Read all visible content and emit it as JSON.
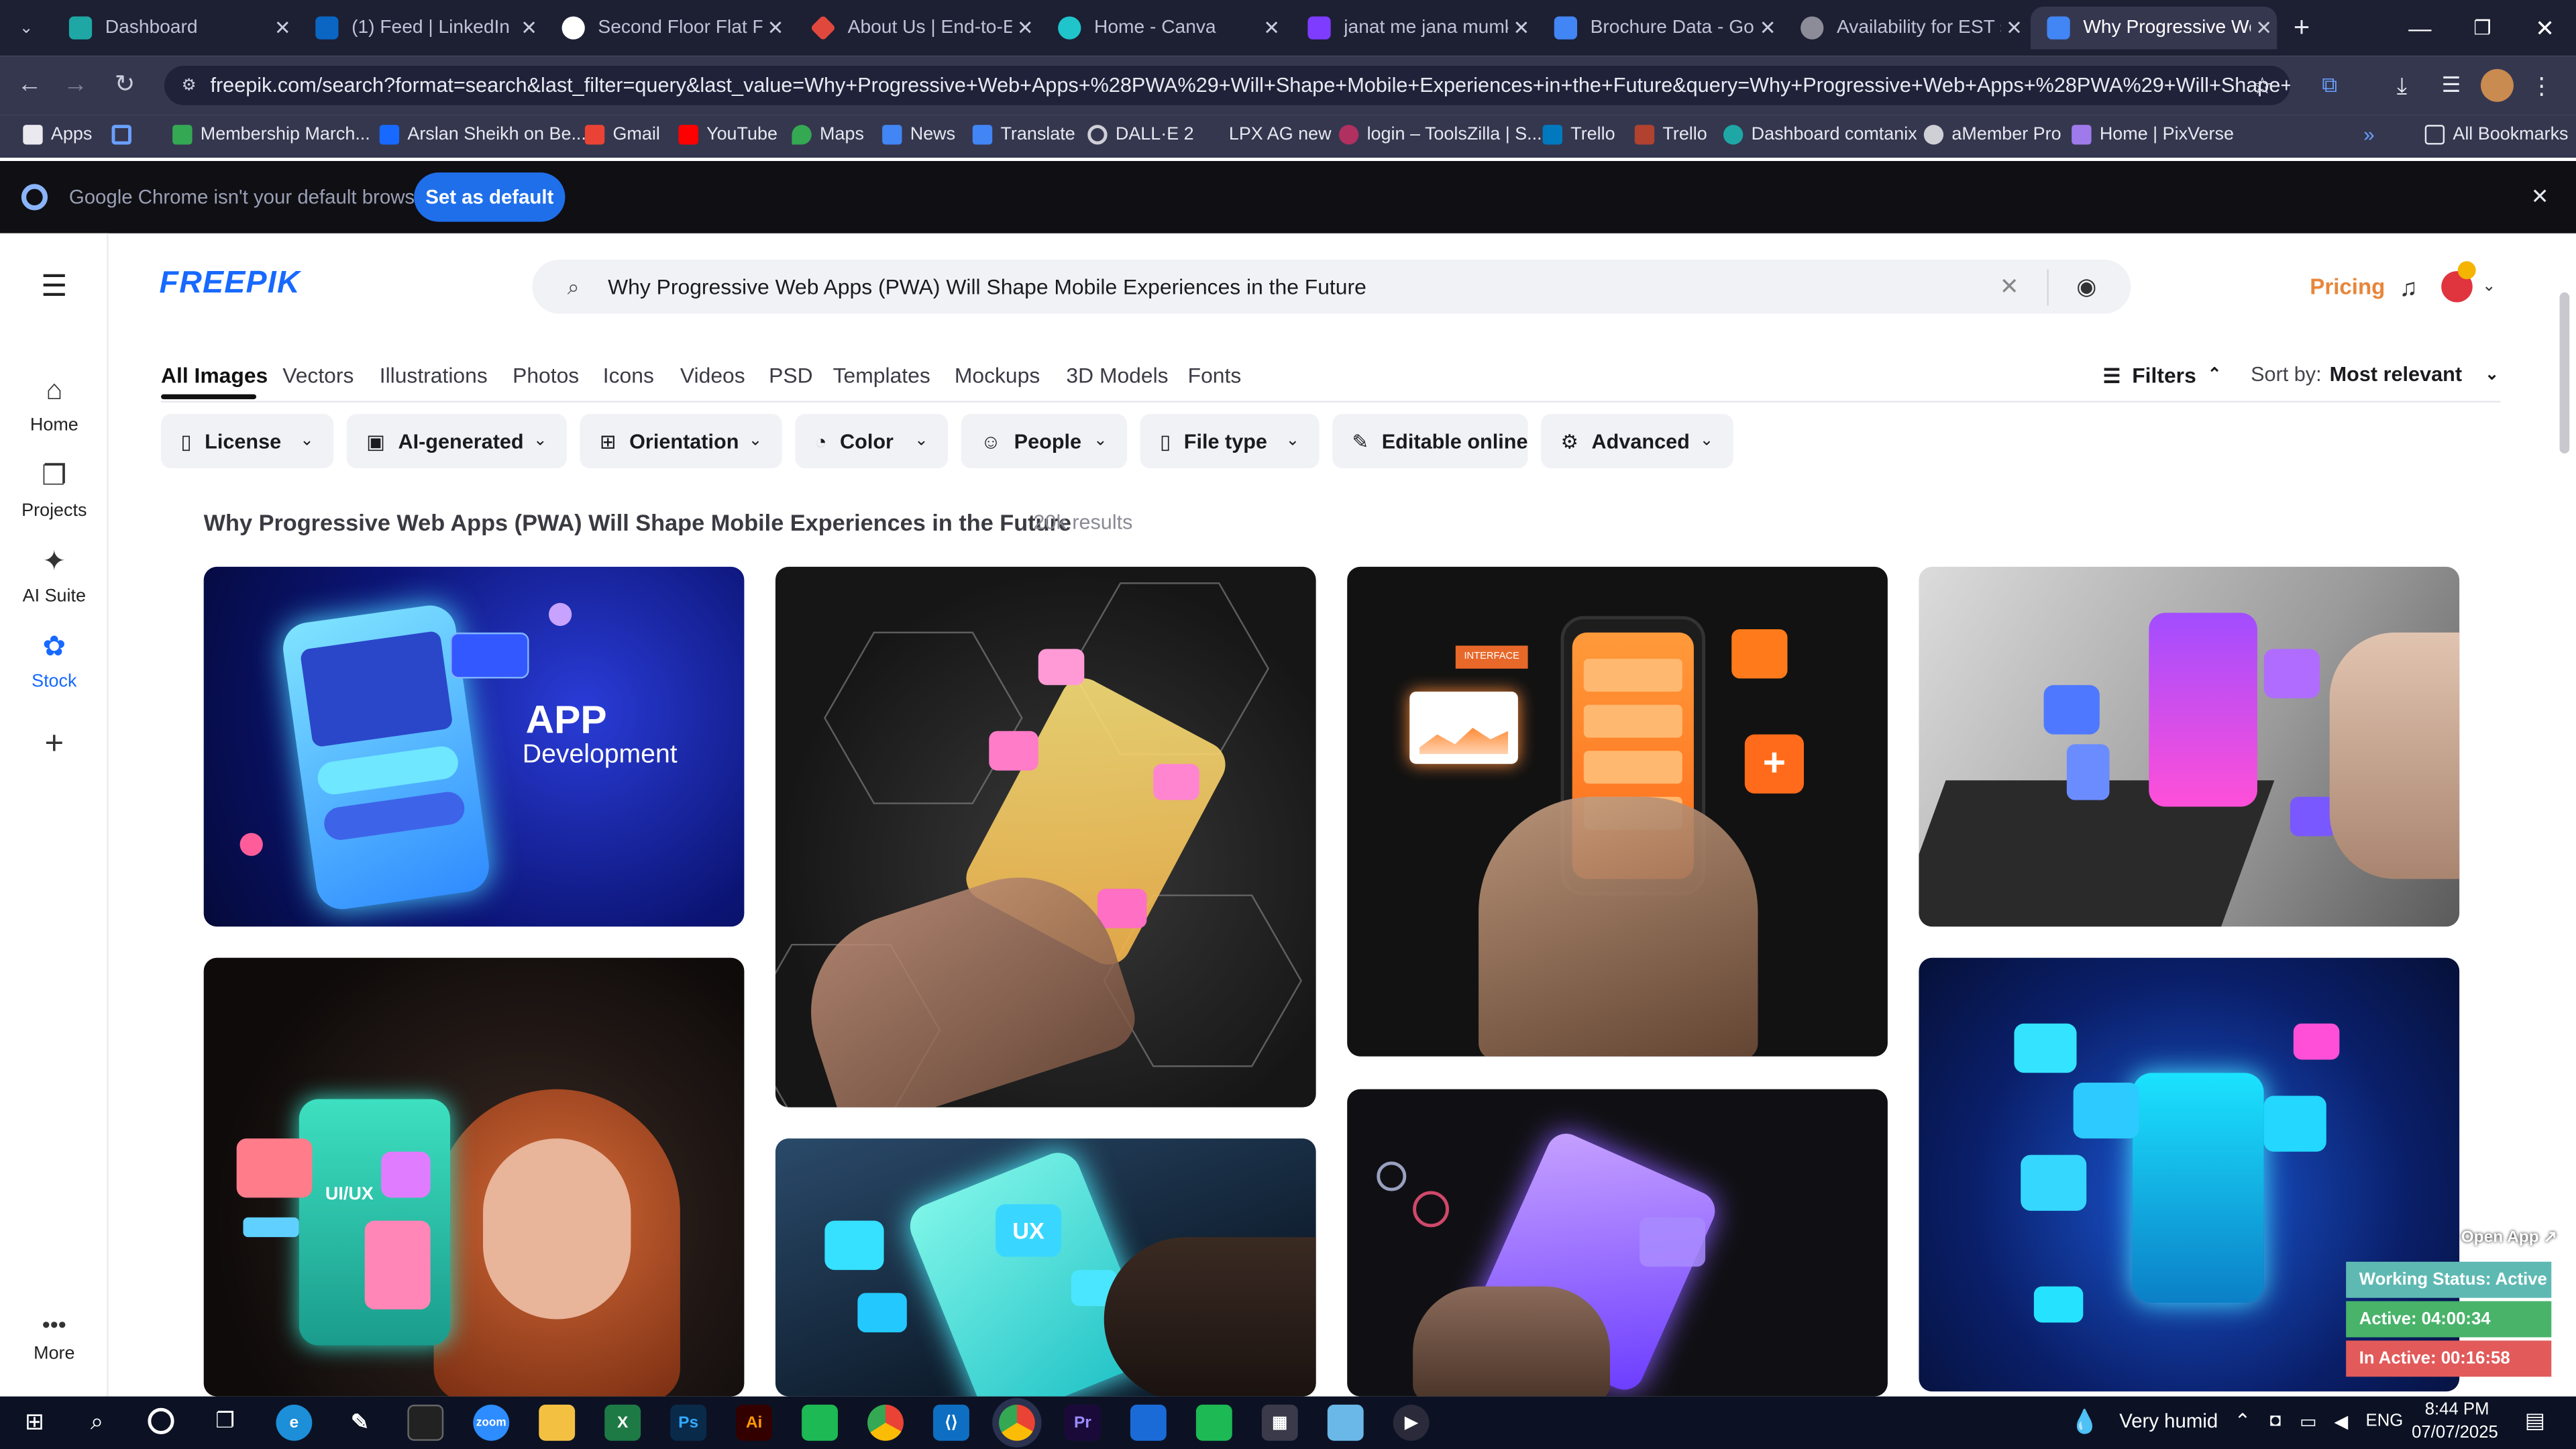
{
  "browser": {
    "tabs": [
      {
        "title": "Dashboard",
        "color": "#1ea7a5"
      },
      {
        "title": "(1) Feed | LinkedIn",
        "color": "#0a66c2"
      },
      {
        "title": "Second Floor Flat For",
        "color": "#7b6cf0"
      },
      {
        "title": "About Us | End-to-En",
        "color": "#e0483e"
      },
      {
        "title": "Home - Canva",
        "color": "#20c4cb"
      },
      {
        "title": "janat me jana mumki",
        "color": "#7d3cff"
      },
      {
        "title": "Brochure Data - Goo",
        "color": "#4285f4"
      },
      {
        "title": "Availability for EST s",
        "color": "#8c8c99"
      },
      {
        "title": "Why Progressive Web",
        "color": "#4285f4"
      }
    ],
    "new_tab": "+",
    "url": "freepik.com/search?format=search&last_filter=query&last_value=Why+Progressive+Web+Apps+%28PWA%29+Will+Shape+Mobile+Experiences+in+the+Future&query=Why+Progressive+Web+Apps+%28PWA%29+Will+Shape+Mobile+Ex...",
    "bookmarks": [
      {
        "label": "Apps",
        "color": "#e9e9ef"
      },
      {
        "label": "Membership March...",
        "color": "#34a853"
      },
      {
        "label": "Arslan Sheikh on Be...",
        "color": "#1769ff"
      },
      {
        "label": "Gmail",
        "color": "#ea4335"
      },
      {
        "label": "YouTube",
        "color": "#ff0000"
      },
      {
        "label": "Maps",
        "color": "#34a853"
      },
      {
        "label": "News",
        "color": "#4285f4"
      },
      {
        "label": "Translate",
        "color": "#4285f4"
      },
      {
        "label": "DALL·E 2",
        "color": "#cfcfd6"
      },
      {
        "label": "LPX AG new",
        "color": "#35374f"
      },
      {
        "label": "login – ToolsZilla | S...",
        "color": "#b03060"
      },
      {
        "label": "Trello",
        "color": "#0079bf"
      },
      {
        "label": "Trello",
        "color": "#b0422f"
      },
      {
        "label": "Dashboard comtanix",
        "color": "#1ea7a5"
      },
      {
        "label": "aMember Pro",
        "color": "#cfcfd6"
      },
      {
        "label": "Home | PixVerse",
        "color": "#9f7aea"
      }
    ],
    "all_bookmarks": "All Bookmarks",
    "infobar_text": "Google Chrome isn't your default browser",
    "infobar_button": "Set as default"
  },
  "freepik": {
    "logo": "FREEPIK",
    "search_query": "Why Progressive Web Apps (PWA) Will Shape Mobile Experiences in the Future",
    "pricing": "Pricing",
    "sidebar": [
      {
        "label": "Home",
        "icon": "home-icon"
      },
      {
        "label": "Projects",
        "icon": "projects-icon"
      },
      {
        "label": "AI Suite",
        "icon": "ai-suite-icon"
      },
      {
        "label": "Stock",
        "icon": "stock-icon"
      }
    ],
    "more_label": "More",
    "type_tabs": [
      "All Images",
      "Vectors",
      "Illustrations",
      "Photos",
      "Icons",
      "Videos",
      "PSD",
      "Templates",
      "Mockups",
      "3D Models",
      "Fonts"
    ],
    "filters_label": "Filters",
    "sort_label": "Sort by:",
    "sort_value": "Most relevant",
    "filter_chips": [
      "License",
      "AI-generated",
      "Orientation",
      "Color",
      "People",
      "File type",
      "Editable online",
      "Advanced"
    ],
    "results_title": "Why Progressive Web Apps (PWA) Will Shape Mobile Experiences in the Future",
    "results_count": "20k results",
    "cards": [
      {
        "id": "app-dev",
        "text_big": "APP",
        "text_small": "Development"
      },
      {
        "id": "hands-hex"
      },
      {
        "id": "orange-phone",
        "label": "INTERFACE"
      },
      {
        "id": "laptop-phone"
      },
      {
        "id": "girl-uiux",
        "label": "UI/UX"
      },
      {
        "id": "cyan-phone",
        "label": "UX"
      },
      {
        "id": "purple-phone"
      },
      {
        "id": "neon-phone"
      }
    ]
  },
  "tracker": {
    "open_app": "Open App ↗",
    "working": "Working Status: Active",
    "active": "Active: 04:00:34",
    "inactive": "In Active: 00:16:58"
  },
  "taskbar": {
    "weather": "Very humid",
    "lang": "ENG",
    "time": "8:44 PM",
    "date": "07/07/2025"
  },
  "colors": {
    "brand": "#1769ff",
    "pricing": "#e8863a",
    "tab_bar": "#1d1f33",
    "toolbar": "#35374f"
  }
}
